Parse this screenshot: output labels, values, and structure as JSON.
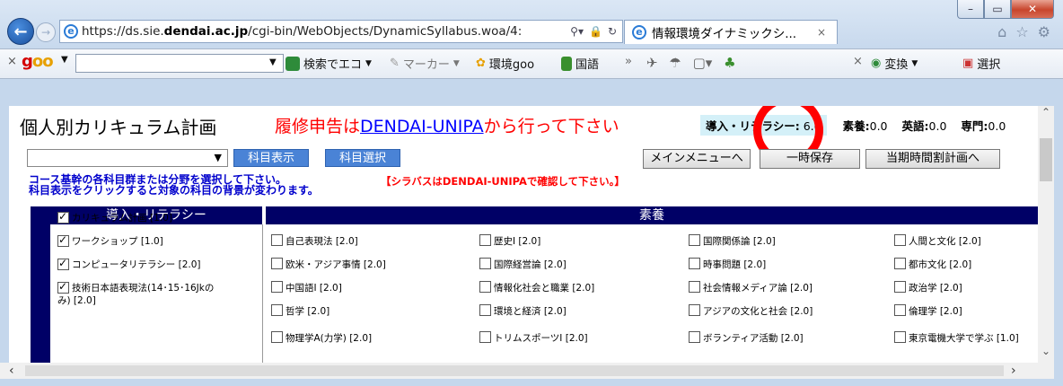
{
  "window": {
    "caption_buttons": [
      "minimize-icon",
      "maximize-icon",
      "close-icon"
    ]
  },
  "browser": {
    "back_icon": "back-arrow-icon",
    "forward_icon": "forward-arrow-icon",
    "address": {
      "prefix": "https://ds.sie.",
      "domain_bold": "dendai.ac.jp",
      "suffix": "/cgi-bin/WebObjects/DynamicSyllabus.woa/4:"
    },
    "tab_title": "情報環境ダイナミックシ...",
    "tab_close": "×"
  },
  "goo_toolbar": {
    "close": "×",
    "logo": "goo",
    "search_eco": "検索でエコ",
    "marker": "マーカー",
    "env_goo": "環境goo",
    "kokugo": "国語",
    "close2": "×",
    "henkan": "変換",
    "sentaku": "選択"
  },
  "page": {
    "title": "個人別カリキュラム計画",
    "notice_prefix": "履修申告は",
    "notice_link": "DENDAI-UNIPA",
    "notice_suffix": "から行って下さい",
    "credits": {
      "intro_label": "導入・リテラシー:",
      "intro_value": "6.0",
      "kyoyo_label": "素養:",
      "kyoyo_value": "0.0",
      "eigo_label": "英語:",
      "eigo_value": "0.0",
      "senmon_label": "専門:",
      "senmon_value": "0.0"
    },
    "buttons": {
      "kamoku_hyoji": "科目表示",
      "kamoku_sentaku": "科目選択",
      "main_menu": "メインメニューへ",
      "ichiji_hozon": "一時保存",
      "touki_jikanwari": "当期時間割計画へ"
    },
    "instructions_line1": "コース基幹の各科目群または分野を選択して下さい。",
    "instructions_line2": "科目表示をクリックすると対象の科目の背景が変わります。",
    "syllabus_note": "【シラバスはDENDAI-UNIPAで確認して下さい。】",
    "headers": {
      "intro": "導入・リテラシー",
      "kyoyo": "素養"
    },
    "intro_courses": [
      {
        "label": "カリキュラム計画 [1.0]",
        "checked": true
      },
      {
        "label": "ワークショップ [1.0]",
        "checked": true
      },
      {
        "label": "コンピュータリテラシー [2.0]",
        "checked": true
      },
      {
        "label": "技術日本語表現法(14･15･16Jkの",
        "label2": "み) [2.0]",
        "checked": true
      }
    ],
    "kyoyo_courses": [
      [
        "自己表現法 [2.0]",
        "歴史Ⅰ [2.0]",
        "国際関係論 [2.0]",
        "人間と文化 [2.0]"
      ],
      [
        "欧米・アジア事情 [2.0]",
        "国際経営論 [2.0]",
        "時事問題 [2.0]",
        "都市文化 [2.0]"
      ],
      [
        "中国語Ⅰ [2.0]",
        "情報化社会と職業 [2.0]",
        "社会情報メディア論 [2.0]",
        "政治学 [2.0]"
      ],
      [
        "哲学 [2.0]",
        "環境と経済 [2.0]",
        "アジアの文化と社会 [2.0]",
        "倫理学 [2.0]"
      ],
      [
        "物理学A(力学) [2.0]",
        "トリムスポーツⅠ [2.0]",
        "ボランティア活動 [2.0]",
        "東京電機大学で学ぶ [1.0]"
      ]
    ]
  }
}
